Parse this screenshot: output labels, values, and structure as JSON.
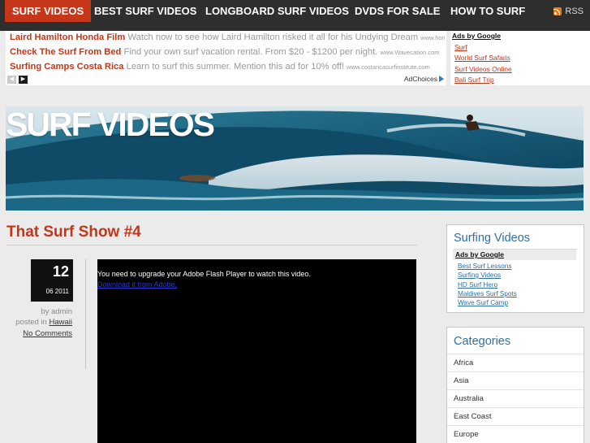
{
  "nav": {
    "items": [
      "SURF VIDEOS",
      "BEST SURF VIDEOS",
      "LONGBOARD SURF VIDEOS",
      "DVDS FOR SALE",
      "HOW TO SURF"
    ],
    "rss_label": "RSS"
  },
  "ads": {
    "lines": [
      {
        "title": "Laird Hamilton Honda Film",
        "text": "Watch now to see how Laird Hamilton risked it all for his Undying Dream",
        "url": "www.honda.c..."
      },
      {
        "title": "Check The Surf From Bed",
        "text": "Find your own surf vacation rental. From $20 - $1200 per night.",
        "url": "www.Wavecation.com"
      },
      {
        "title": "Surfing Camps Costa Rica",
        "text": "Learn to surf this summer. Mention this ad for 10% off!",
        "url": "www.costaricasurfinstitute.com"
      }
    ],
    "prev_icon": "arrow-left-icon",
    "next_icon": "arrow-right-icon",
    "adchoices_label": "AdChoices"
  },
  "ad_links_top": {
    "heading": "Ads by Google",
    "links": [
      "Surf",
      "World Surf Safaris",
      "Surf Videos Online",
      "Bali Surf Trip"
    ]
  },
  "banner": {
    "title": "SURF VIDEOS"
  },
  "post": {
    "title": "That Surf Show #4",
    "day": "12",
    "month_year": "06 2011",
    "by_label": "by admin",
    "posted_in_label": "posted in",
    "category": "Hawaii",
    "comments": "No Comments",
    "video_message": "You need to upgrade your Adobe Flash Player to watch this video.",
    "video_link": "Download it from Adobe."
  },
  "sidebar": {
    "surf_videos": {
      "title": "Surfing Videos",
      "ads_heading": "Ads by Google",
      "links": [
        "Best Surf Lessons",
        "Surfing Videos",
        "HD Surf Hero",
        "Maldives Surf Spots",
        "Wave Surf Camp"
      ]
    },
    "categories": {
      "title": "Categories",
      "items": [
        "Africa",
        "Asia",
        "Australia",
        "East Coast",
        "Europe"
      ]
    }
  },
  "colors": {
    "accent": "#c63619",
    "nav_bg": "#2e2e2e",
    "sidebar_title": "#2f6fa6"
  }
}
